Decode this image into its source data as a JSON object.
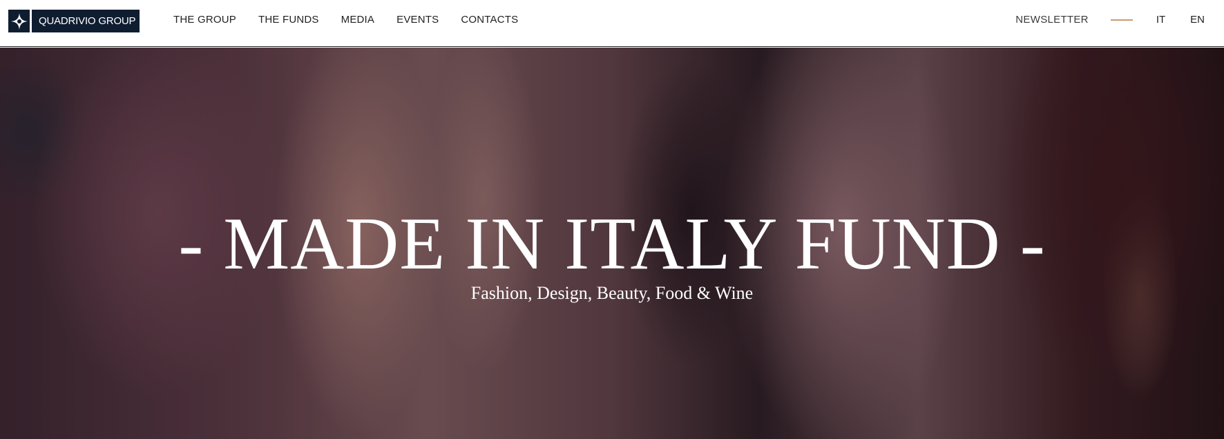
{
  "header": {
    "logo_text": "QUADRIVIO GROUP",
    "nav": [
      "THE GROUP",
      "THE FUNDS",
      "MEDIA",
      "EVENTS",
      "CONTACTS"
    ],
    "newsletter": "NEWSLETTER",
    "languages": [
      "IT",
      "EN"
    ]
  },
  "hero": {
    "title": "- MADE IN ITALY FUND -",
    "subtitle": "Fashion, Design, Beauty, Food & Wine"
  },
  "colors": {
    "brand_navy": "#0f1d31",
    "accent": "#c79a6e"
  }
}
